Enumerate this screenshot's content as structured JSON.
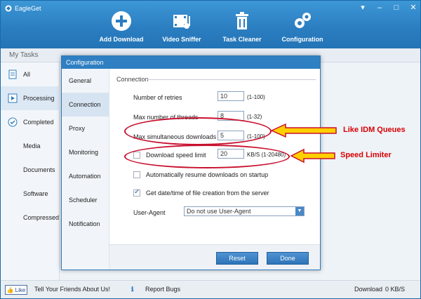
{
  "app": {
    "title": "EagleGet",
    "window_controls": [
      "▾",
      "–",
      "□",
      "✕"
    ]
  },
  "toolbar": [
    {
      "label": "Add Download",
      "icon": "plus-circle-icon"
    },
    {
      "label": "Video Sniffer",
      "icon": "film-note-icon"
    },
    {
      "label": "Task Cleaner",
      "icon": "trash-icon"
    },
    {
      "label": "Configuration",
      "icon": "gears-icon"
    }
  ],
  "tasks_header": "My Tasks",
  "sidebar": [
    {
      "label": "All",
      "icon": "document-icon"
    },
    {
      "label": "Processing",
      "icon": "play-icon"
    },
    {
      "label": "Completed",
      "icon": "check-circle-icon"
    },
    {
      "label": "Media"
    },
    {
      "label": "Documents"
    },
    {
      "label": "Software"
    },
    {
      "label": "Compressed"
    }
  ],
  "dialog": {
    "title": "Configuration",
    "nav": [
      "General",
      "Connection",
      "Proxy",
      "Monitoring",
      "Automation",
      "Scheduler",
      "Notification"
    ],
    "active_nav": "Connection",
    "section": "Connection",
    "retries": {
      "label": "Number of retries",
      "value": "10",
      "range": "(1-100)"
    },
    "threads": {
      "label": "Max number of threads",
      "value": "8",
      "range": "(1-32)"
    },
    "simultaneous": {
      "label": "Max simultaneous downloads",
      "value": "5",
      "range": "(1-100)"
    },
    "speed_limit": {
      "label": "Download speed limit",
      "value": "20",
      "range": "KB/S (1-20480)",
      "checked": false
    },
    "auto_resume": {
      "label": "Automatically resume downloads on startup",
      "checked": false
    },
    "get_date": {
      "label": "Get date/time of file creation from the server",
      "checked": true
    },
    "user_agent": {
      "label": "User-Agent",
      "value": "Do not use User-Agent"
    },
    "buttons": {
      "reset": "Reset",
      "done": "Done"
    }
  },
  "annotations": {
    "queues": "Like IDM Queues",
    "speed": "Speed Limiter",
    "color": "#d80000"
  },
  "bottom": {
    "like": "Like",
    "tell": "Tell Your Friends About Us!",
    "report": "Report Bugs",
    "download": "Download",
    "speed": "0 KB/S"
  },
  "colors": {
    "titlebar": "#2a7dc0",
    "accent": "#2f7fc2",
    "annotation": "#c8102e"
  }
}
